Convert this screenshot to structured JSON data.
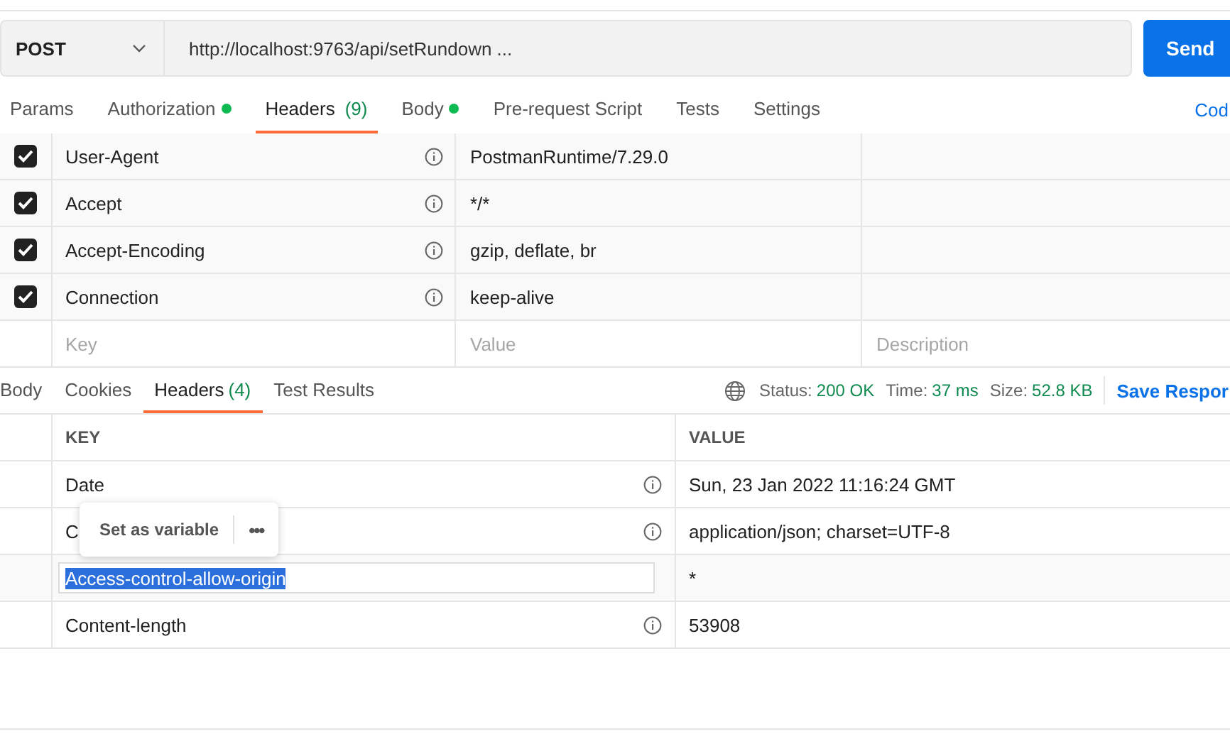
{
  "request": {
    "method": "POST",
    "url": "http://localhost:9763/api/setRundown ...",
    "send": "Send"
  },
  "request_tabs": [
    {
      "label": "Params",
      "dot": false,
      "selected": false
    },
    {
      "label": "Authorization",
      "dot": true,
      "selected": false
    },
    {
      "label": "Headers",
      "count": "(9)",
      "dot": false,
      "selected": true
    },
    {
      "label": "Body",
      "dot": true,
      "selected": false
    },
    {
      "label": "Pre-request Script",
      "dot": false,
      "selected": false
    },
    {
      "label": "Tests",
      "dot": false,
      "selected": false
    },
    {
      "label": "Settings",
      "dot": false,
      "selected": false
    }
  ],
  "code_link": "Cod",
  "request_headers": {
    "rows": [
      {
        "checked": true,
        "key": "User-Agent",
        "value": "PostmanRuntime/7.29.0"
      },
      {
        "checked": true,
        "key": "Accept",
        "value": "*/*"
      },
      {
        "checked": true,
        "key": "Accept-Encoding",
        "value": "gzip, deflate, br"
      },
      {
        "checked": true,
        "key": "Connection",
        "value": "keep-alive"
      }
    ],
    "new_row": {
      "key": {
        "placeholder": "Key"
      },
      "value": {
        "placeholder": "Value"
      },
      "description": {
        "placeholder": "Description"
      }
    }
  },
  "response_tabs": [
    {
      "label": "Body",
      "selected": false
    },
    {
      "label": "Cookies",
      "selected": false
    },
    {
      "label": "Headers",
      "count": "(4)",
      "selected": true
    },
    {
      "label": "Test Results",
      "selected": false
    }
  ],
  "response_meta": [
    {
      "label": "Status:",
      "value": "200 OK"
    },
    {
      "label": "Time:",
      "value": "37 ms"
    },
    {
      "label": "Size:",
      "value": "52.8 KB"
    }
  ],
  "save_response": "Save Respor",
  "response_headers": {
    "columns": [
      "KEY",
      "VALUE"
    ],
    "rows": [
      {
        "kind": "normal",
        "key": "Date",
        "value": "Sun, 23 Jan 2022 11:16:24 GMT"
      },
      {
        "kind": "normal",
        "key": "C",
        "value": "application/json; charset=UTF-8"
      },
      {
        "kind": "editing",
        "key": "Access-control-allow-origin",
        "value": "*"
      },
      {
        "kind": "normal",
        "key": "Content-length",
        "value": "53908"
      }
    ]
  },
  "context_menu": {
    "label": "Set as variable",
    "more": "•••"
  }
}
